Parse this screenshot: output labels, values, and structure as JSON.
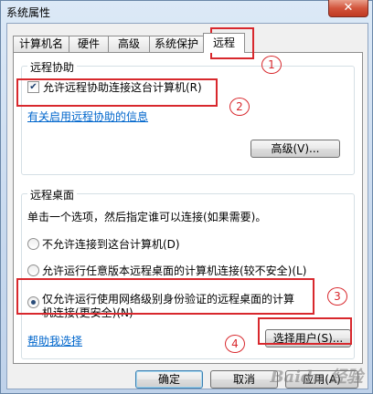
{
  "window": {
    "title": "系统属性",
    "close_label": "✕"
  },
  "tabs": [
    {
      "label": "计算机名"
    },
    {
      "label": "硬件"
    },
    {
      "label": "高级"
    },
    {
      "label": "系统保护"
    },
    {
      "label": "远程"
    }
  ],
  "remote_assistance": {
    "group_title": "远程协助",
    "allow_checkbox_label": "允许远程协助连接这台计算机(R)",
    "allow_checked": true,
    "info_link": "有关启用远程协助的信息",
    "advanced_button": "高级(V)..."
  },
  "remote_desktop": {
    "group_title": "远程桌面",
    "instruction": "单击一个选项，然后指定谁可以连接(如果需要)。",
    "option_no_connect": "不允许连接到这台计算机(D)",
    "option_any_version": "允许运行任意版本远程桌面的计算机连接(较不安全)(L)",
    "option_nla_line1": "仅允许运行使用网络级别身份验证的远程桌面的计算",
    "option_nla_line2": "机连接(更安全)(N)",
    "selected_option": "option_nla",
    "help_link": "帮助我选择",
    "select_users_button": "选择用户(S)..."
  },
  "footer": {
    "ok": "确定",
    "cancel": "取消",
    "apply": "应用(A)"
  },
  "annotations": [
    "1",
    "2",
    "3",
    "4"
  ],
  "watermark": "Baidu 经验",
  "colors": {
    "annotation": "#d8282d",
    "link": "#0066cc"
  }
}
